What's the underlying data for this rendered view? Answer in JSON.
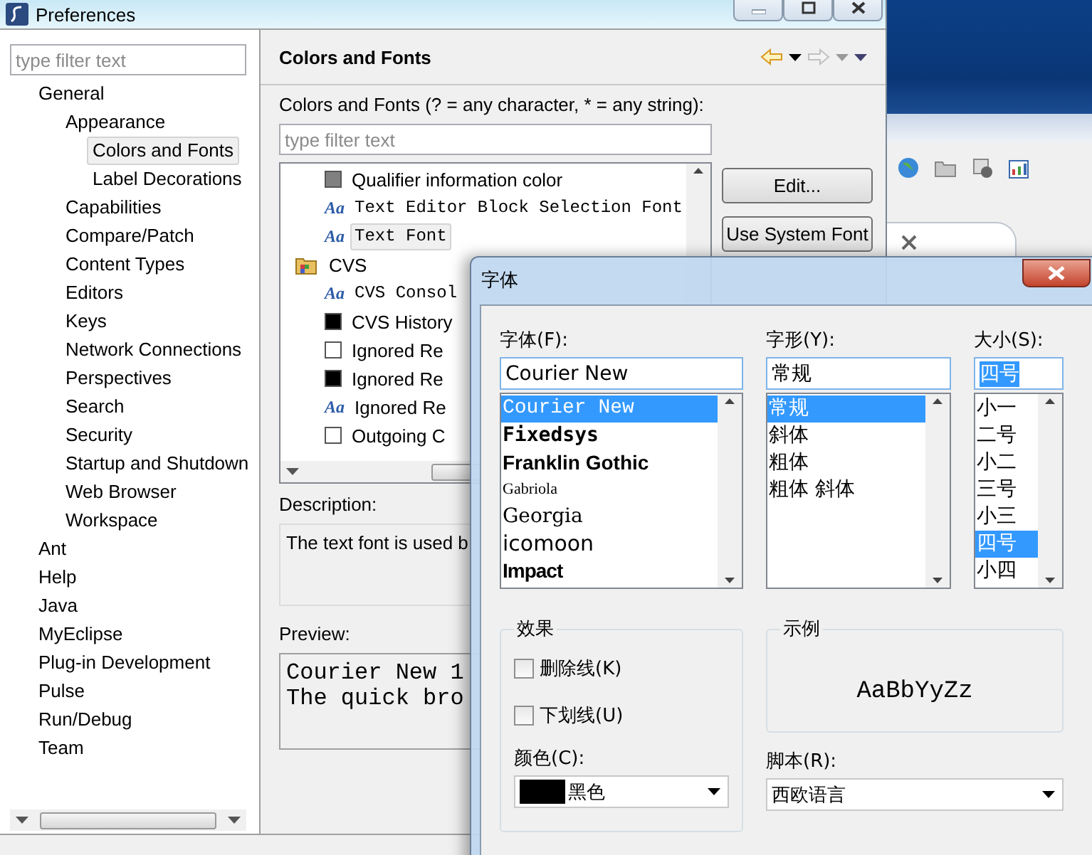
{
  "preferences": {
    "title": "Preferences",
    "filter": {
      "placeholder": "type filter text"
    },
    "tree": [
      {
        "label": "General",
        "selected": false,
        "children": [
          {
            "label": "Appearance",
            "selected": false,
            "children": [
              {
                "label": "Colors and Fonts",
                "selected": true
              },
              {
                "label": "Label Decorations",
                "selected": false
              }
            ]
          },
          {
            "label": "Capabilities",
            "selected": false
          },
          {
            "label": "Compare/Patch",
            "selected": false
          },
          {
            "label": "Content Types",
            "selected": false
          },
          {
            "label": "Editors",
            "selected": false
          },
          {
            "label": "Keys",
            "selected": false
          },
          {
            "label": "Network Connections",
            "selected": false
          },
          {
            "label": "Perspectives",
            "selected": false
          },
          {
            "label": "Search",
            "selected": false
          },
          {
            "label": "Security",
            "selected": false
          },
          {
            "label": "Startup and Shutdown",
            "selected": false
          },
          {
            "label": "Web Browser",
            "selected": false
          },
          {
            "label": "Workspace",
            "selected": false
          }
        ]
      },
      {
        "label": "Ant",
        "selected": false
      },
      {
        "label": "Help",
        "selected": false
      },
      {
        "label": "Java",
        "selected": false
      },
      {
        "label": "MyEclipse",
        "selected": false
      },
      {
        "label": "Plug-in Development",
        "selected": false
      },
      {
        "label": "Pulse",
        "selected": false
      },
      {
        "label": "Run/Debug",
        "selected": false
      },
      {
        "label": "Team",
        "selected": false
      }
    ],
    "page": {
      "title": "Colors and Fonts",
      "filter_label": "Colors and Fonts (? = any character, * = any string):",
      "filter": {
        "placeholder": "type filter text"
      },
      "items": [
        {
          "kind": "group",
          "children": [
            {
              "kind": "color",
              "label": "Qualifier information color",
              "color": "#808080",
              "selected": false
            },
            {
              "kind": "monofont",
              "icon": "Aa",
              "label": "Text Editor Block Selection Font",
              "selected": false
            },
            {
              "kind": "monofont",
              "icon": "Aa",
              "label": "Text Font",
              "selected": true
            }
          ]
        },
        {
          "kind": "category",
          "label": "CVS",
          "selected": false,
          "children": [
            {
              "kind": "monofont",
              "icon": "Aa",
              "label": "CVS Consol",
              "selected": false
            },
            {
              "kind": "color",
              "label": "CVS History",
              "color": "#000000",
              "selected": false
            },
            {
              "kind": "color",
              "label": "Ignored Re",
              "color": "#ffffff",
              "selected": false
            },
            {
              "kind": "color",
              "label": "Ignored Re",
              "color": "#000000",
              "selected": false
            },
            {
              "kind": "font",
              "icon": "Aa",
              "label": "Ignored Re",
              "selected": false
            },
            {
              "kind": "color",
              "label": "Outgoing C",
              "color": "#ffffff",
              "selected": false
            }
          ]
        }
      ],
      "buttons": [
        "Edit...",
        "Use System Font"
      ],
      "description_label": "Description:",
      "description": "The text font is used b",
      "preview_label": "Preview:",
      "preview": [
        "Courier New 1",
        "The quick bro"
      ]
    }
  },
  "font_dialog": {
    "title": "字体",
    "font": {
      "label": "字体(F):",
      "value": "Courier New",
      "options": [
        {
          "label": "Courier New",
          "selected": true
        },
        {
          "label": "Fixedsys",
          "selected": false
        },
        {
          "label": "Franklin Gothic",
          "selected": false
        },
        {
          "label": "Gabriola",
          "selected": false
        },
        {
          "label": "Georgia",
          "selected": false
        },
        {
          "label": "icomoon",
          "selected": false
        },
        {
          "label": "Impact",
          "selected": false
        }
      ]
    },
    "style": {
      "label": "字形(Y):",
      "value": "常规",
      "options": [
        {
          "label": "常规",
          "selected": true
        },
        {
          "label": "斜体",
          "selected": false
        },
        {
          "label": "粗体",
          "selected": false
        },
        {
          "label": "粗体 斜体",
          "selected": false
        }
      ]
    },
    "size": {
      "label": "大小(S):",
      "value": "四号",
      "value_selected": true,
      "options": [
        {
          "label": "小一",
          "selected": false
        },
        {
          "label": "二号",
          "selected": false
        },
        {
          "label": "小二",
          "selected": false
        },
        {
          "label": "三号",
          "selected": false
        },
        {
          "label": "小三",
          "selected": false
        },
        {
          "label": "四号",
          "selected": true
        },
        {
          "label": "小四",
          "selected": false
        }
      ]
    },
    "effects": {
      "title": "效果",
      "checkboxes": [
        {
          "label": "删除线(K)",
          "checked": false
        },
        {
          "label": "下划线(U)",
          "checked": false
        }
      ],
      "color_label": "颜色(C):",
      "color_value": {
        "label": "黑色",
        "color": "#000000"
      }
    },
    "sample": {
      "title": "示例",
      "text": "AaBbYyZz"
    },
    "script": {
      "label": "脚本(R):",
      "value": "西欧语言"
    }
  }
}
